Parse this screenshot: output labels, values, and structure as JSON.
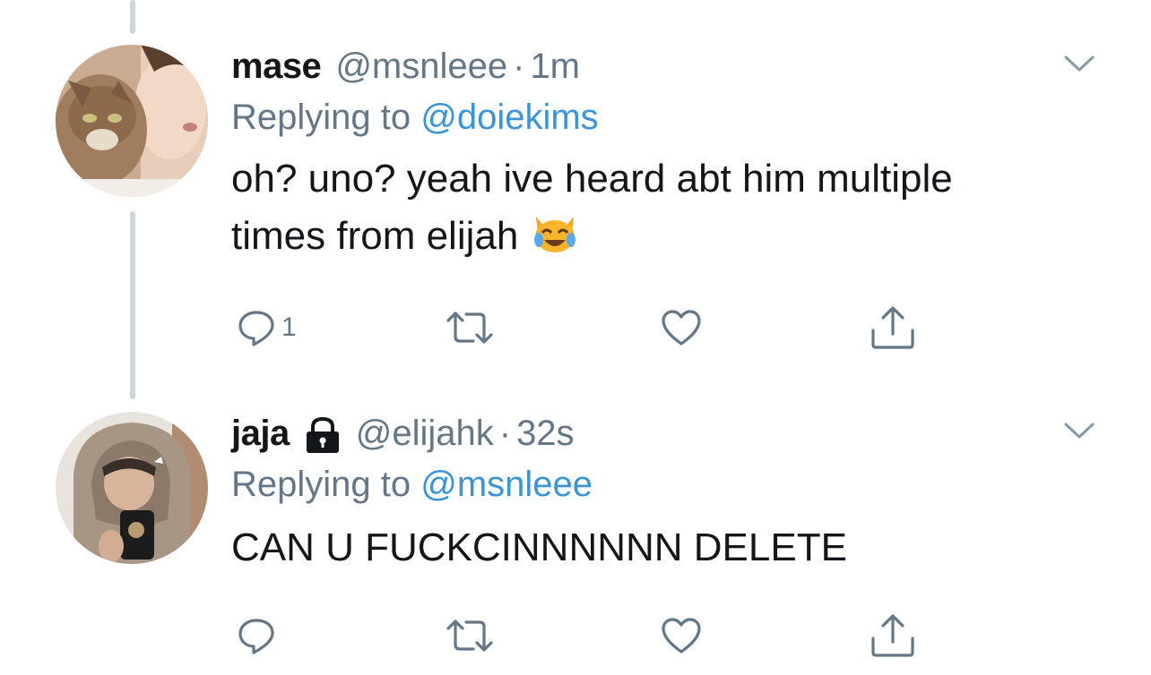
{
  "tweets": [
    {
      "name": "mase",
      "handle": "@msnleee",
      "separator": "·",
      "time": "1m",
      "replying_prefix": "Replying to ",
      "replying_to": "@doiekims",
      "text_line1": "oh? uno? yeah ive heard abt him multiple",
      "text_line2": "times from elijah",
      "emoji": "joy-cat-emoji",
      "reply_count": "1",
      "locked": false
    },
    {
      "name": "jaja",
      "handle": "@elijahk",
      "separator": "·",
      "time": "32s",
      "replying_prefix": "Replying to ",
      "replying_to": "@msnleee",
      "text_line1": "CAN U FUCKCINNNNNN DELETE",
      "reply_count": "",
      "locked": true
    }
  ],
  "icons": {
    "reply": "reply-icon",
    "retweet": "retweet-icon",
    "like": "heart-icon",
    "share": "share-icon",
    "more": "chevron-down-icon",
    "lock": "lock-icon"
  },
  "colors": {
    "text": "#14171a",
    "muted": "#657786",
    "link": "#3b94d9",
    "thread_line": "#ccd6dd"
  }
}
